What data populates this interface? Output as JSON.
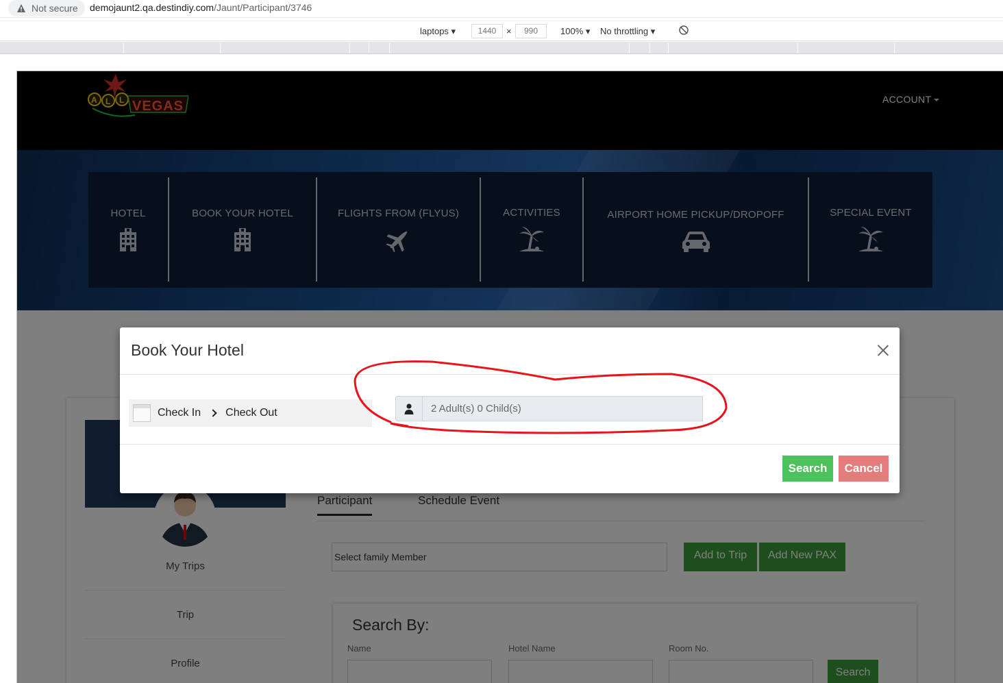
{
  "browser": {
    "security_label": "Not secure",
    "url_host": "demojaunt2.qa.destindiy.com",
    "url_path": "/Jaunt/Participant/3746"
  },
  "devtools": {
    "device": "laptops",
    "width": "1440",
    "times": "×",
    "height": "990",
    "zoom": "100%",
    "throttling": "No throttling"
  },
  "header": {
    "logo_text": "ALL VEGAS",
    "account_label": "ACCOUNT"
  },
  "nav": {
    "items": [
      {
        "label": "HOTEL",
        "icon": "building-icon"
      },
      {
        "label": "BOOK YOUR HOTEL",
        "icon": "building-icon"
      },
      {
        "label": "FLIGHTS FROM (FLYUS)",
        "icon": "plane-icon"
      },
      {
        "label": "ACTIVITIES",
        "icon": "palm-tree-icon"
      },
      {
        "label": "AIRPORT HOME PICKUP/DROPOFF",
        "icon": "car-icon"
      },
      {
        "label": "SPECIAL EVENT",
        "icon": "palm-tree-icon"
      }
    ]
  },
  "sidebar": {
    "links": [
      "My Trips",
      "Trip",
      "Profile"
    ]
  },
  "tabs": {
    "participant": "Participant",
    "schedule": "Schedule Event"
  },
  "family": {
    "placeholder": "Select family Member",
    "add_to_trip": "Add to Trip",
    "add_new_pax": "Add New PAX"
  },
  "search_by": {
    "title": "Search By:",
    "name_label": "Name",
    "hotel_label": "Hotel Name",
    "room_label": "Room No.",
    "button": "Search"
  },
  "modal": {
    "title": "Book Your Hotel",
    "check_in": "Check In",
    "check_out": "Check Out",
    "pax_value": "2 Adult(s) 0 Child(s)",
    "search_button": "Search",
    "cancel_button": "Cancel"
  },
  "colors": {
    "search_green": "#4cc25a",
    "cancel_red": "#e57c7c",
    "annotation_red": "#e8141c"
  }
}
